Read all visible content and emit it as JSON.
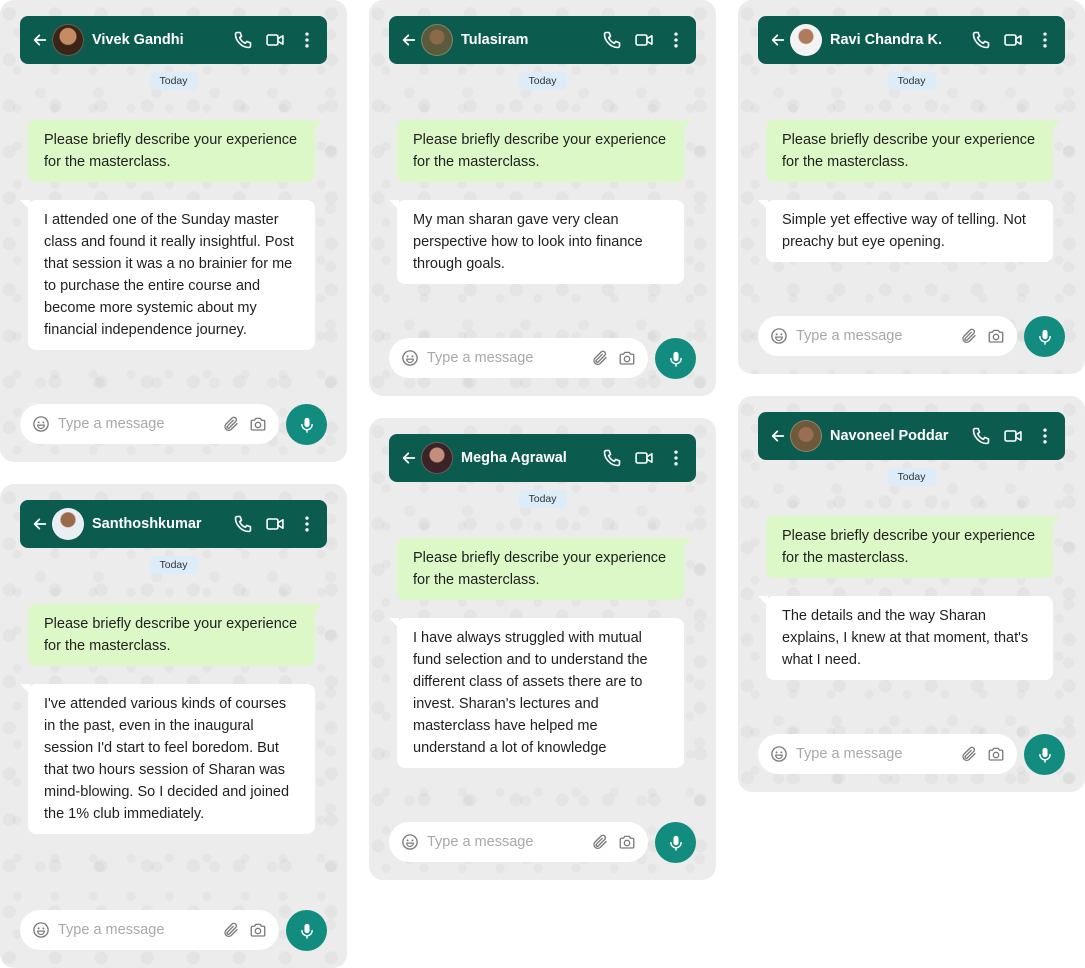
{
  "colors": {
    "header": "#0b5c4e",
    "outgoing_bubble": "#dcf8c6",
    "incoming_bubble": "#ffffff",
    "mic_button": "#128c7e",
    "date_chip": "#dcecf8",
    "card_background": "#ececec"
  },
  "icons": [
    "back-arrow-icon",
    "phone-icon",
    "video-icon",
    "more-vertical-icon",
    "emoji-icon",
    "attach-icon",
    "camera-icon",
    "mic-icon"
  ],
  "chats": [
    {
      "contact": "Vivek Gandhi",
      "date": "Today",
      "question": "Please briefly describe your experience for the masterclass.",
      "reply": "I attended one of the Sunday master class and found it really insightful. Post that session it was a no brainier for me to purchase the entire course and become more systemic about my financial independence journey.",
      "input_placeholder": "Type a message"
    },
    {
      "contact": "Tulasiram",
      "date": "Today",
      "question": "Please briefly describe your experience for the masterclass.",
      "reply": "My man sharan gave very clean perspective how to look into finance through goals.",
      "input_placeholder": "Type a message"
    },
    {
      "contact": "Ravi Chandra K.",
      "date": "Today",
      "question": "Please briefly describe your experience for the masterclass.",
      "reply": "Simple yet effective way of telling. Not preachy but eye opening.",
      "input_placeholder": "Type a message"
    },
    {
      "contact": "Santhoshkumar",
      "date": "Today",
      "question": "Please briefly describe your experience for the masterclass.",
      "reply": "I've attended various kinds of courses in the past, even in the inaugural session I'd start to feel boredom. But that two hours session of Sharan was mind-blowing. So I decided and joined the 1% club immediately.",
      "input_placeholder": "Type a message"
    },
    {
      "contact": "Megha Agrawal",
      "date": "Today",
      "question": "Please briefly describe your experience for the masterclass.",
      "reply": "I have always struggled with mutual fund selection and to understand the different class of assets there are to invest. Sharan's lectures and masterclass have helped me understand a lot of knowledge",
      "input_placeholder": "Type a message"
    },
    {
      "contact": "Navoneel Poddar",
      "date": "Today",
      "question": "Please briefly describe your experience for the masterclass.",
      "reply": "The details and the way Sharan explains, I knew at that moment, that's what I need.",
      "input_placeholder": "Type a message"
    }
  ]
}
